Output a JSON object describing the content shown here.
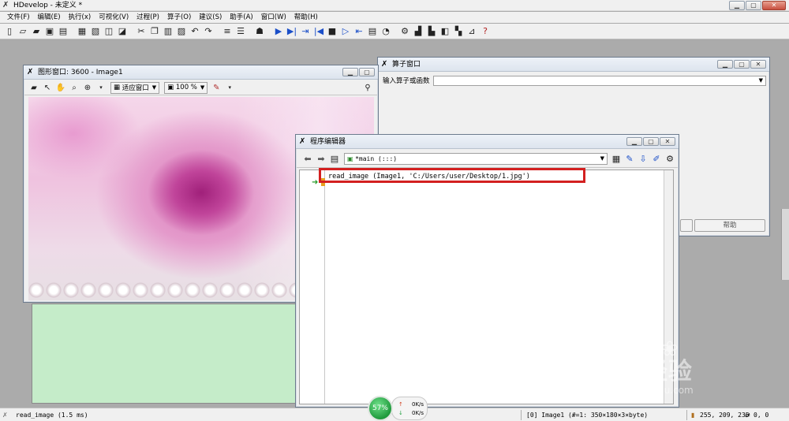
{
  "app": {
    "title": "HDevelop - 未定义 *",
    "window_buttons": [
      "▁",
      "▢",
      "✕"
    ]
  },
  "menu": [
    "文件(F)",
    "编辑(E)",
    "执行(x)",
    "可视化(V)",
    "过程(P)",
    "算子(O)",
    "建议(S)",
    "助手(A)",
    "窗口(W)",
    "帮助(H)"
  ],
  "toolbar": {
    "icons": [
      "new-file-icon",
      "open-file-icon",
      "open-example-icon",
      "save-icon",
      "save-as-icon",
      "print-icon",
      "export-icon",
      "properties-icon",
      "cut-icon",
      "copy-icon",
      "paste-icon",
      "delete-icon",
      "undo-icon",
      "redo-icon",
      "insert-icon",
      "edit-icon",
      "read-image-icon",
      "run-icon",
      "step-over-icon",
      "step-into-icon",
      "step-back-icon",
      "stop-icon",
      "reset-icon",
      "step-out-icon",
      "clear-icon",
      "timer-icon",
      "settings-icon",
      "chart-icon",
      "histogram-icon",
      "inspect-icon",
      "zoom-icon",
      "measure-icon",
      "help-icon"
    ]
  },
  "graphics_window": {
    "title": "图形窗口: 3600 - Image1",
    "fit_label": "适应窗口",
    "zoom_label": "100 %"
  },
  "operator_window": {
    "title": "算子窗口",
    "input_label": "输入算子或函数",
    "input_value": "",
    "help_button": "帮助"
  },
  "program_editor": {
    "title": "程序编辑器",
    "procedure": "*main (:::)",
    "code_lines": [
      "read_image (Image1, 'C:/Users/user/Desktop/1.jpg')"
    ]
  },
  "status": {
    "last_op": "read_image (1.5 ms)",
    "image_info": "[0] Image1 (#=1: 350×180×3×byte)",
    "pixel_value": "255, 209, 235",
    "coords": "0, 0"
  },
  "net_gauge": {
    "percent": "57%",
    "up_rate": "0K/s",
    "down_rate": "0K/s"
  },
  "watermark": {
    "brand": "Bai 经验",
    "url": "jingyan.baidu.com"
  },
  "colors": {
    "highlight_box": "#d32020",
    "graphics_bottom_panel": "#c5ecc9",
    "gauge": "#1f9a3c"
  }
}
